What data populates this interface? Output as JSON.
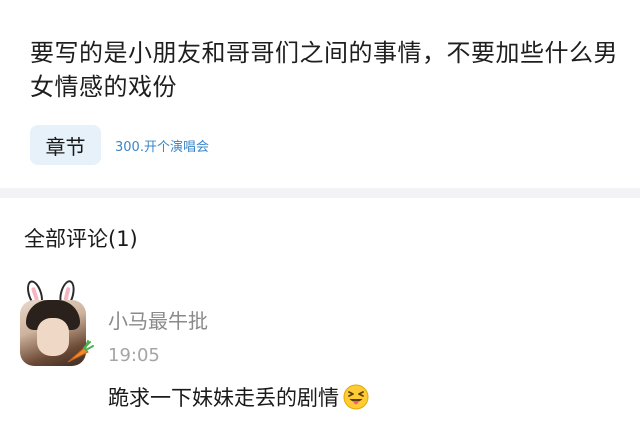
{
  "post": {
    "text": "要写的是小朋友和哥哥们之间的事情，不要加些什么男女情感的戏份"
  },
  "chapter": {
    "badge_label": "章节",
    "link_text": "300.开个演唱会"
  },
  "comments": {
    "header": "全部评论(1)",
    "items": [
      {
        "username": "小马最牛批",
        "time": "19:05",
        "text": "跪求一下妹妹走丢的剧情",
        "emoji": "squinting-tongue-emoji"
      }
    ]
  },
  "colors": {
    "accent": "#3a86c8",
    "badge_bg": "#e6f1fa",
    "divider": "#f3f3f5",
    "muted_text": "#8a8a8a"
  }
}
